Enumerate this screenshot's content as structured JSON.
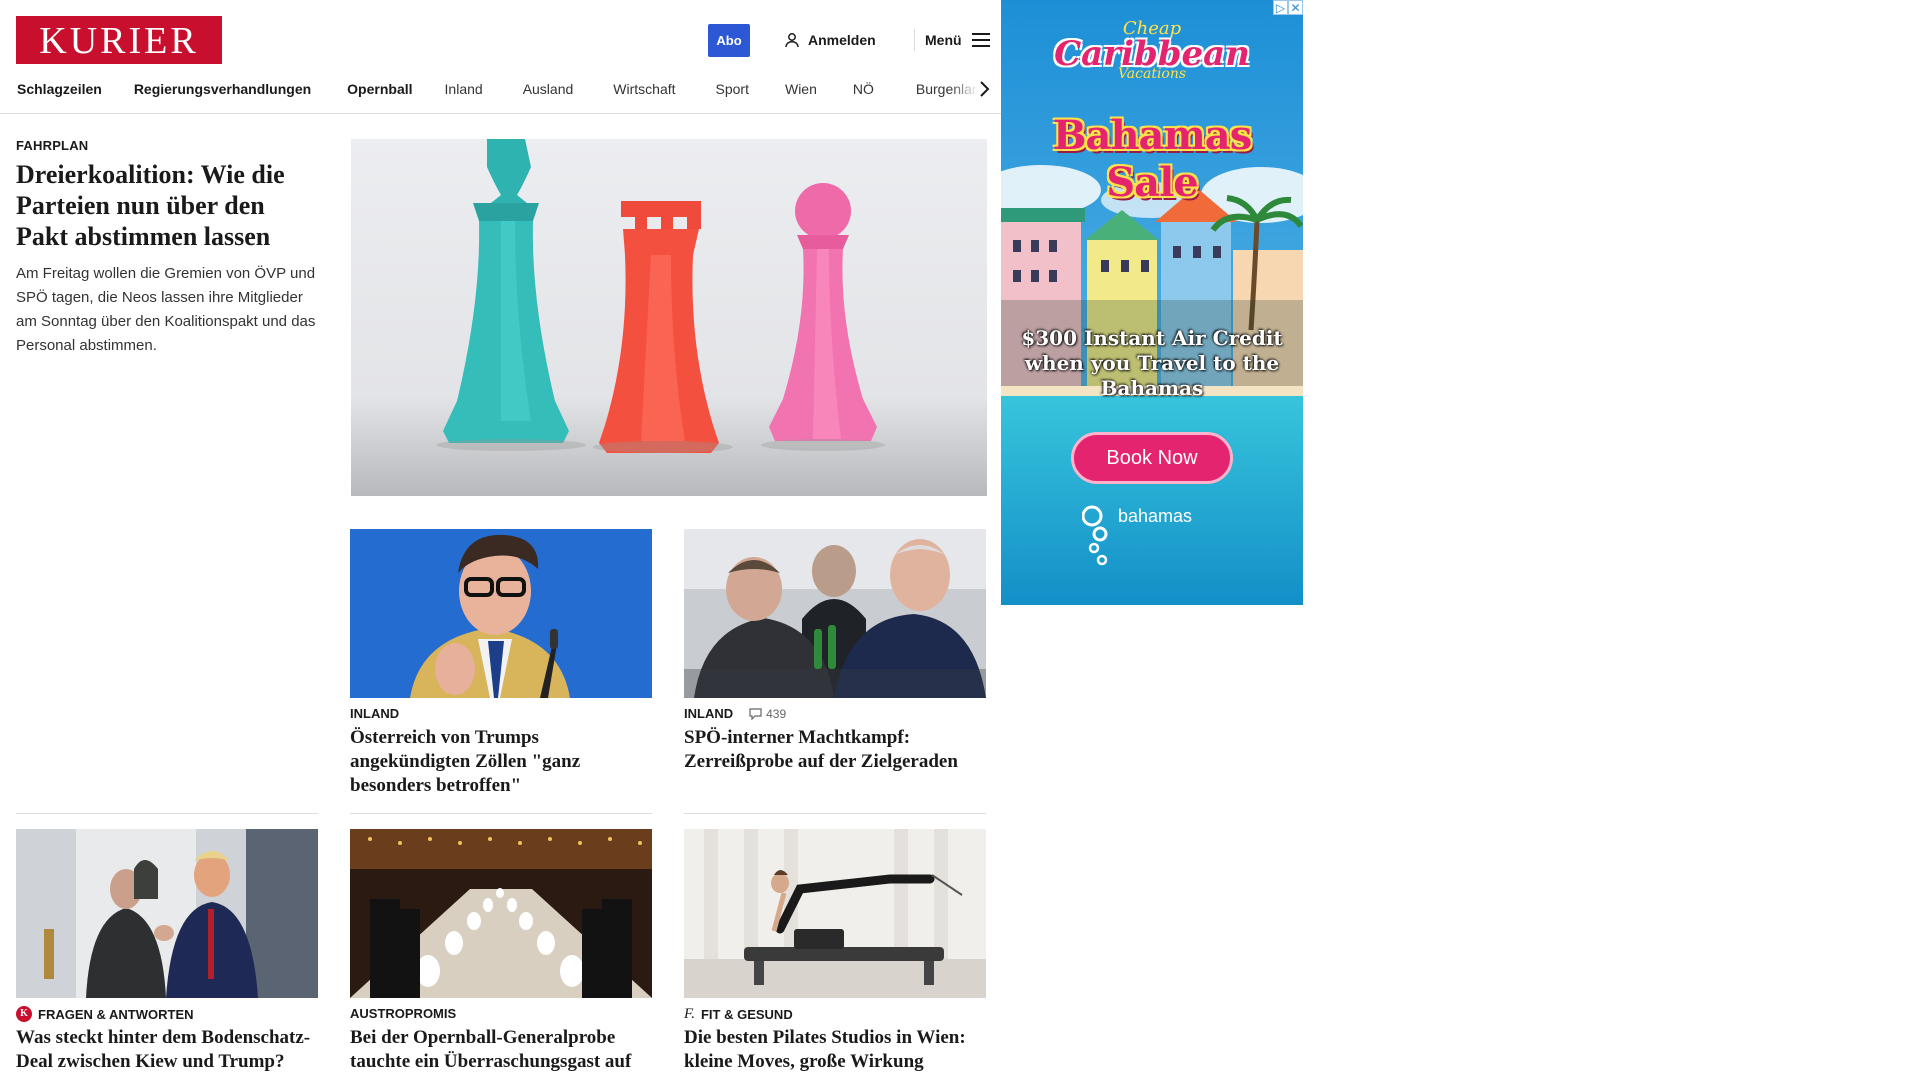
{
  "header": {
    "logo": "KURIER",
    "abo_label": "Abo",
    "login_label": "Anmelden",
    "menu_label": "Menü"
  },
  "nav": {
    "items": [
      "Schlagzeilen",
      "Regierungsverhandlungen",
      "Opernball",
      "Inland",
      "Ausland",
      "Wirtschaft",
      "Sport",
      "Wien",
      "NÖ",
      "Burgenland"
    ]
  },
  "lead": {
    "kicker": "FAHRPLAN",
    "title": "Dreierkoalition: Wie die Parteien nun über den Pakt abstimmen lassen",
    "teaser": "Am Freitag wollen die Gremien von ÖVP und SPÖ tagen, die Neos lassen ihre Mitglieder am Sonntag über den Koalitionspakt und das Personal abstimmen."
  },
  "articles": [
    {
      "kicker": "INLAND",
      "title": "Österreich von Trumps angekündigten Zöllen \"ganz besonders betroffen\""
    },
    {
      "kicker": "INLAND",
      "comments": "439",
      "title": "SPÖ-interner Machtkampf: Zerreißprobe auf der Zielgeraden"
    },
    {
      "kicker": "FRAGEN & ANTWORTEN",
      "badge": "K",
      "title": "Was steckt hinter dem Bodenschatz-Deal zwischen Kiew und Trump?"
    },
    {
      "kicker": "AUSTROPROMIS",
      "title": "Bei der Opernball-Generalprobe tauchte ein Überraschungsgast auf"
    },
    {
      "kicker": "FIT & GESUND",
      "badge": "f.",
      "title": "Die besten Pilates Studios in Wien: kleine Moves, große Wirkung"
    }
  ],
  "ad": {
    "top_line": "Cheap",
    "brand": "Caribbean",
    "sub_line": "Vacations",
    "headline": "Bahamas Sale",
    "offer": "$300 Instant Air Credit when you Travel to the Bahamas",
    "cta": "Book Now",
    "logo": "bahamas"
  },
  "colors": {
    "brand_red": "#c8102e",
    "abo_blue": "#2c58d6",
    "ad_pink": "#e5246f"
  }
}
